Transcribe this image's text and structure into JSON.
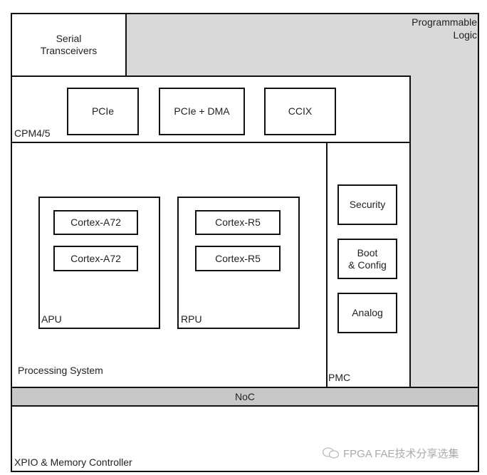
{
  "programmable_logic": {
    "label_line1": "Programmable",
    "label_line2": "Logic",
    "color": "#d9d9d9"
  },
  "serial_transceivers": {
    "line1": "Serial",
    "line2": "Transceivers"
  },
  "cpm": {
    "label": "CPM4/5",
    "blocks": [
      "PCIe",
      "PCIe + DMA",
      "CCIX"
    ]
  },
  "processing_system": {
    "label": "Processing System",
    "apu": {
      "label": "APU",
      "cores": [
        "Cortex-A72",
        "Cortex-A72"
      ]
    },
    "rpu": {
      "label": "RPU",
      "cores": [
        "Cortex-R5",
        "Cortex-R5"
      ]
    }
  },
  "pmc": {
    "label": "PMC",
    "security": "Security",
    "boot_line1": "Boot",
    "boot_line2": "& Config",
    "analog": "Analog"
  },
  "noc": {
    "label": "NoC",
    "color": "#c8c8c8"
  },
  "xpio": {
    "label": "XPIO & Memory Controller"
  },
  "watermark": {
    "text": "FPGA FAE技术分享选集",
    "icon": "wechat-icon"
  }
}
